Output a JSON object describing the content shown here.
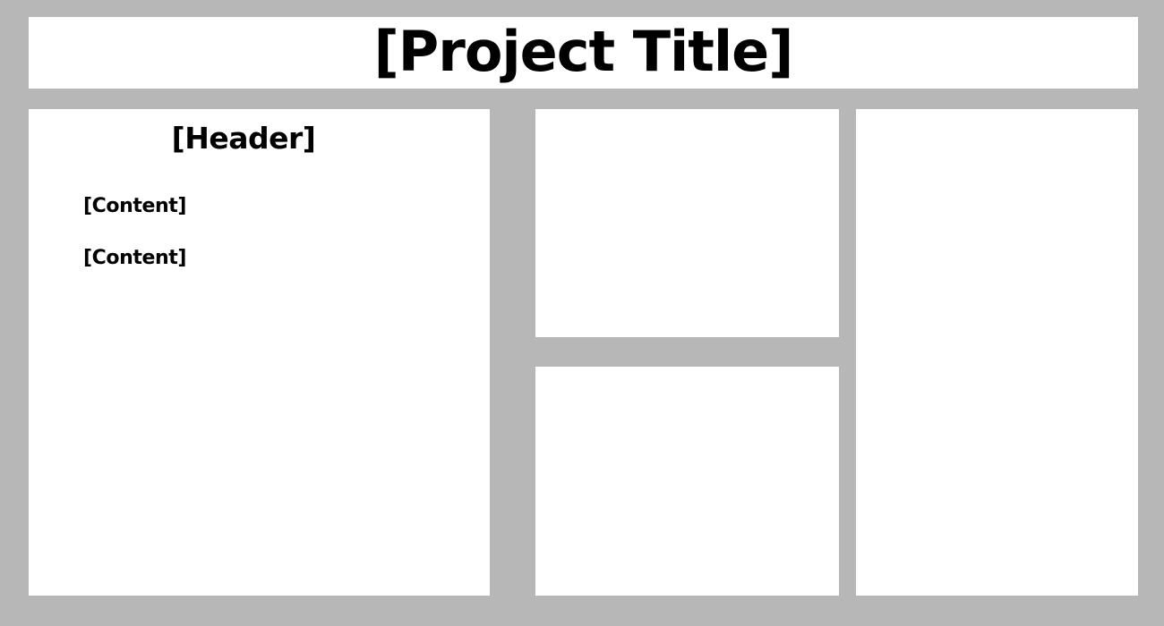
{
  "title": "[Project Title]",
  "left_panel": {
    "header": "[Header]",
    "content": [
      "[Content]",
      "[Content]"
    ]
  },
  "colors": {
    "background": "#b7b7b7",
    "panel": "#ffffff",
    "text": "#000000"
  }
}
